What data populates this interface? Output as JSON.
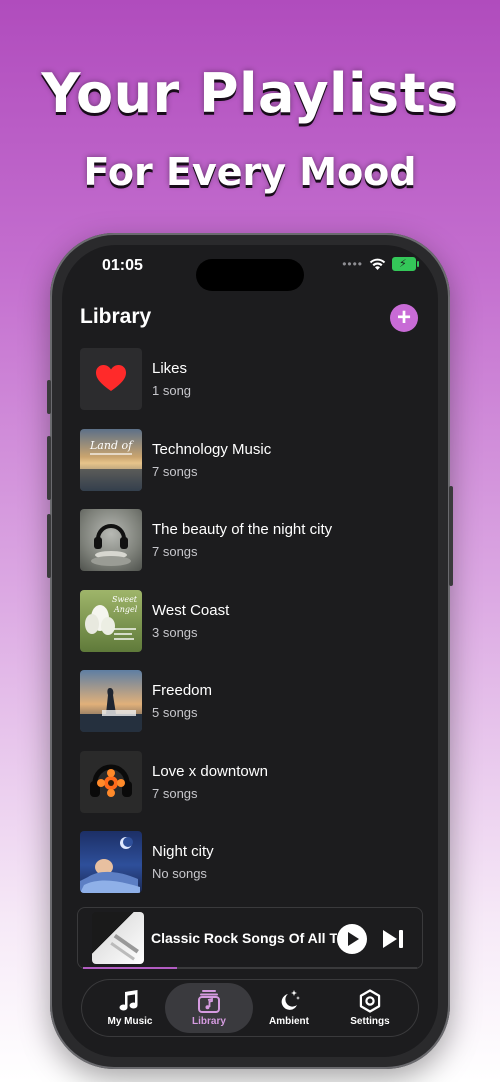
{
  "promo": {
    "headline": "Your Playlists",
    "subheadline": "For Every Mood"
  },
  "status_bar": {
    "time": "01:05"
  },
  "library": {
    "title": "Library",
    "add_icon": "plus-circle-icon",
    "playlists": [
      {
        "title": "Likes",
        "subtitle": "1 song",
        "art": "heart-icon"
      },
      {
        "title": "Technology Music",
        "subtitle": "7 songs",
        "art": "sunset-lake"
      },
      {
        "title": "The beauty of the night city",
        "subtitle": "7 songs",
        "art": "headphones-stones"
      },
      {
        "title": "West Coast",
        "subtitle": "3 songs",
        "art": "white-lotus"
      },
      {
        "title": "Freedom",
        "subtitle": "5 songs",
        "art": "sunset-silhouette"
      },
      {
        "title": "Love x downtown",
        "subtitle": "7 songs",
        "art": "headphones-flower"
      },
      {
        "title": "Night city",
        "subtitle": "No songs",
        "art": "sleeping-moon"
      }
    ]
  },
  "mini_player": {
    "title": "Classic Rock Songs Of All Time",
    "progress": 0.28,
    "play_icon": "play-icon",
    "next_icon": "skip-next-icon"
  },
  "tabs": [
    {
      "label": "My Music",
      "icon": "music-note-icon",
      "active": false
    },
    {
      "label": "Library",
      "icon": "library-note-icon",
      "active": true
    },
    {
      "label": "Ambient",
      "icon": "moon-stars-icon",
      "active": false
    },
    {
      "label": "Settings",
      "icon": "gear-icon",
      "active": false
    }
  ],
  "colors": {
    "accent": "#c86bd6",
    "background_top": "#b04cbd",
    "screen": "#1c1c1e",
    "heart": "#ff2a2a"
  }
}
